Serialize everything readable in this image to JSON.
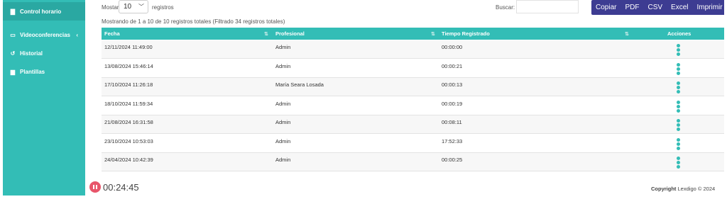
{
  "sidebar": {
    "items": [
      {
        "label": "Control horario",
        "icon": "document-icon",
        "glyph": "▇",
        "active": true
      },
      {
        "label": "Videoconferencias",
        "icon": "video-icon",
        "glyph": "▭",
        "chevron": "‹"
      },
      {
        "label": "Historial",
        "icon": "history-icon",
        "glyph": "↺"
      },
      {
        "label": "Plantillas",
        "icon": "file-icon",
        "glyph": "▆"
      }
    ]
  },
  "toolbar": {
    "length_label": "Mostar",
    "length_value": "10",
    "length_after": "registros",
    "search_label": "Buscar:",
    "search_value": "",
    "buttons": [
      "Copiar",
      "PDF",
      "CSV",
      "Excel",
      "Imprimir"
    ]
  },
  "info": "Mostrando de 1 a 10 de 10 registros totales (Filtrado 34 registros totales)",
  "table": {
    "columns": [
      "Fecha",
      "Profesional",
      "Tiempo Registrado",
      "Acciones"
    ],
    "sort_glyph": "⇅",
    "rows": [
      {
        "fecha": "12/11/2024 11:49:00",
        "profesional": "Admin",
        "tiempo": "00:00:00"
      },
      {
        "fecha": "13/08/2024 15:46:14",
        "profesional": "Admin",
        "tiempo": "00:00:21"
      },
      {
        "fecha": "17/10/2024 11:26:18",
        "profesional": "María Seara Losada",
        "tiempo": "00:00:13"
      },
      {
        "fecha": "18/10/2024 11:59:34",
        "profesional": "Admin",
        "tiempo": "00:00:19"
      },
      {
        "fecha": "21/08/2024 16:31:58",
        "profesional": "Admin",
        "tiempo": "00:08:11"
      },
      {
        "fecha": "23/10/2024 10:53:03",
        "profesional": "Admin",
        "tiempo": "17:52:33"
      },
      {
        "fecha": "24/04/2024 10:42:39",
        "profesional": "Admin",
        "tiempo": "00:00:25"
      }
    ]
  },
  "timer": {
    "value": "00:24:45"
  },
  "footer": {
    "copyright_bold": "Copyright",
    "copyright_text": "Lexdigo © 2024"
  },
  "colors": {
    "accent": "#33bdb6",
    "button_bg": "#3d3c92",
    "pause": "#e8556a"
  }
}
